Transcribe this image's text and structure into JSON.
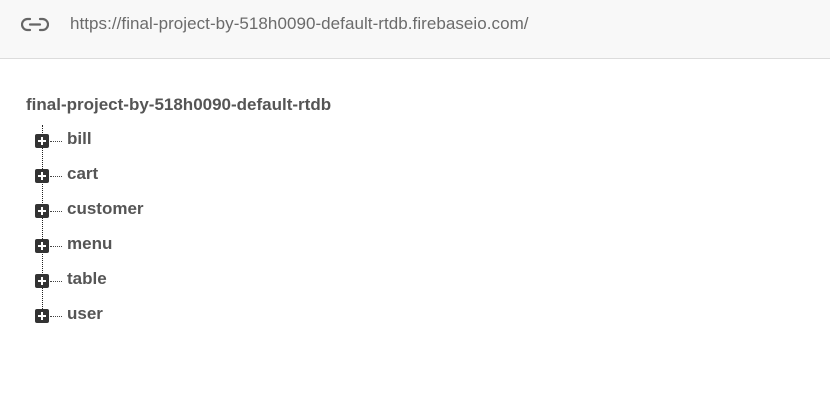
{
  "urlbar": {
    "icon": "link-icon",
    "url": "https://final-project-by-518h0090-default-rtdb.firebaseio.com/"
  },
  "tree": {
    "root": "final-project-by-518h0090-default-rtdb",
    "children": [
      {
        "label": "bill",
        "icon": "expand-plus-icon"
      },
      {
        "label": "cart",
        "icon": "expand-plus-icon"
      },
      {
        "label": "customer",
        "icon": "expand-plus-icon"
      },
      {
        "label": "menu",
        "icon": "expand-plus-icon"
      },
      {
        "label": "table",
        "icon": "expand-plus-icon"
      },
      {
        "label": "user",
        "icon": "expand-plus-icon"
      }
    ]
  }
}
